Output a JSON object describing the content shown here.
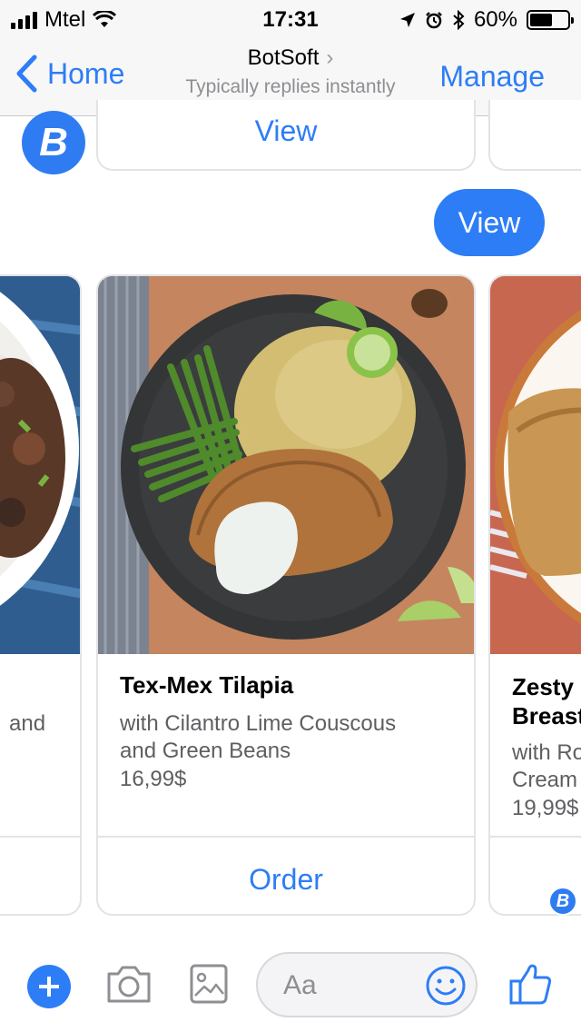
{
  "status_bar": {
    "carrier": "Mtel",
    "time": "17:31",
    "battery": "60%",
    "battery_level": 0.6
  },
  "nav": {
    "back_label": "Home",
    "title": "BotSoft",
    "subtitle": "Typically replies instantly",
    "manage_label": "Manage"
  },
  "chat": {
    "bot_avatar_letter": "B",
    "prev_card_button": "View",
    "user_message": "View"
  },
  "cards": {
    "left": {
      "subtitle_fragment": "and"
    },
    "main": {
      "title": "Tex-Mex Tilapia",
      "subtitle_line1": "with Cilantro Lime Couscous",
      "subtitle_line2": "and Green Beans",
      "price": "16,99$",
      "button": "Order"
    },
    "right": {
      "title_line1": "Zesty",
      "title_line2": "Breast",
      "subtitle_line1": "with Ro",
      "subtitle_line2": "Cream",
      "price": "19,99$"
    }
  },
  "composer": {
    "placeholder": "Aa"
  },
  "colors": {
    "accent": "#2d7df6",
    "bot_brand": "#2f7cf2"
  }
}
